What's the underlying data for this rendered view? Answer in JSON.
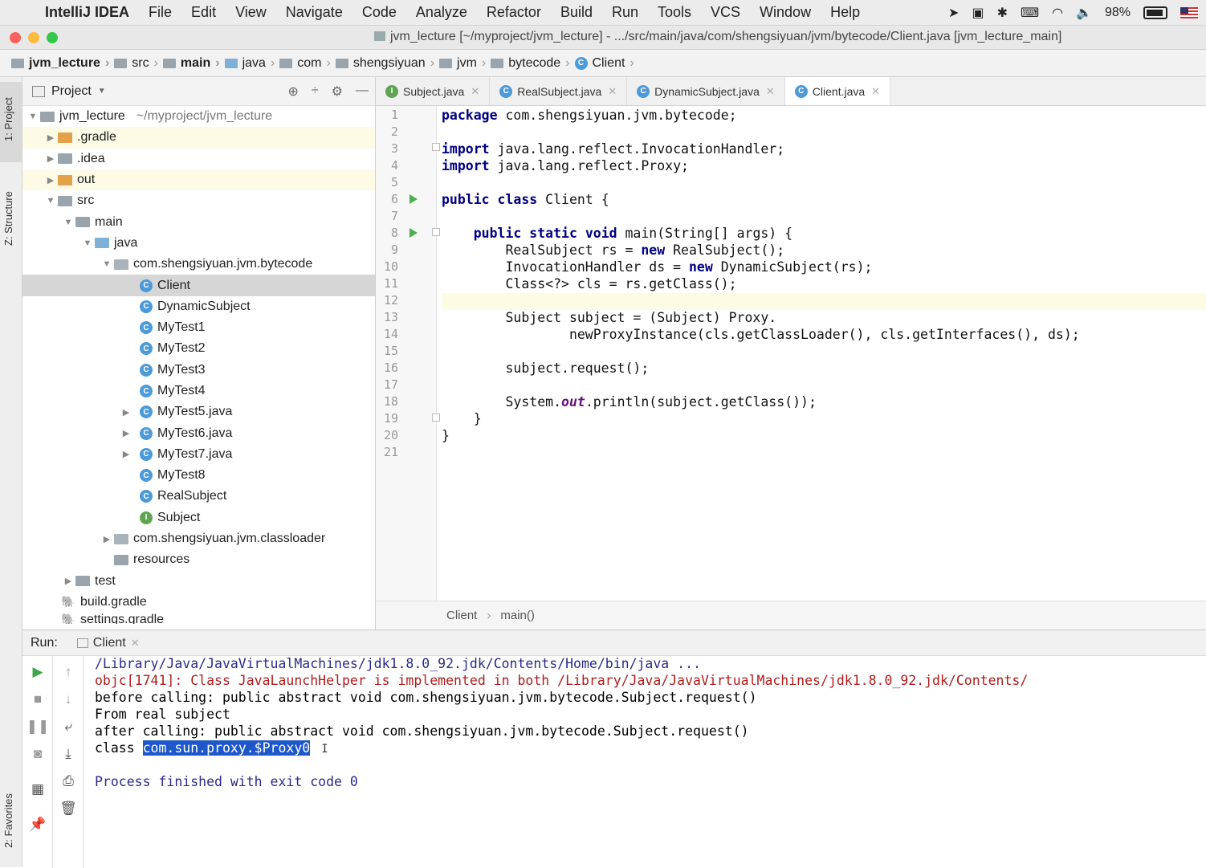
{
  "menubar": {
    "app": "IntelliJ IDEA",
    "items": [
      "File",
      "Edit",
      "View",
      "Navigate",
      "Code",
      "Analyze",
      "Refactor",
      "Build",
      "Run",
      "Tools",
      "VCS",
      "Window",
      "Help"
    ],
    "battery": "98%"
  },
  "window": {
    "title": "jvm_lecture [~/myproject/jvm_lecture] - .../src/main/java/com/shengsiyuan/jvm/bytecode/Client.java [jvm_lecture_main]"
  },
  "breadcrumb": [
    "jvm_lecture",
    "src",
    "main",
    "java",
    "com",
    "shengsiyuan",
    "jvm",
    "bytecode",
    "Client"
  ],
  "left_strip": {
    "project_tab": "1: Project",
    "structure_tab": "Z: Structure",
    "favorites_tab": "2: Favorites"
  },
  "project": {
    "title": "Project",
    "tree": [
      {
        "label": "jvm_lecture",
        "path": "~/myproject/jvm_lecture"
      },
      {
        "label": ".gradle"
      },
      {
        "label": ".idea"
      },
      {
        "label": "out"
      },
      {
        "label": "src"
      },
      {
        "label": "main"
      },
      {
        "label": "java"
      },
      {
        "label": "com.shengsiyuan.jvm.bytecode"
      },
      {
        "label": "Client"
      },
      {
        "label": "DynamicSubject"
      },
      {
        "label": "MyTest1"
      },
      {
        "label": "MyTest2"
      },
      {
        "label": "MyTest3"
      },
      {
        "label": "MyTest4"
      },
      {
        "label": "MyTest5.java"
      },
      {
        "label": "MyTest6.java"
      },
      {
        "label": "MyTest7.java"
      },
      {
        "label": "MyTest8"
      },
      {
        "label": "RealSubject"
      },
      {
        "label": "Subject"
      },
      {
        "label": "com.shengsiyuan.jvm.classloader"
      },
      {
        "label": "resources"
      },
      {
        "label": "test"
      },
      {
        "label": "build.gradle"
      },
      {
        "label": "settings.gradle"
      }
    ]
  },
  "editor": {
    "tabs": [
      "Subject.java",
      "RealSubject.java",
      "DynamicSubject.java",
      "Client.java"
    ],
    "active_tab": "Client.java",
    "line_numbers": [
      "1",
      "2",
      "3",
      "4",
      "5",
      "6",
      "7",
      "8",
      "9",
      "10",
      "11",
      "12",
      "13",
      "14",
      "15",
      "16",
      "17",
      "18",
      "19",
      "20",
      "21"
    ],
    "code": {
      "l1_kw": "package",
      "l1_rest": " com.shengsiyuan.jvm.bytecode;",
      "l3_kw": "import",
      "l3_rest": " java.lang.reflect.InvocationHandler;",
      "l4_kw": "import",
      "l4_rest": " java.lang.reflect.Proxy;",
      "l6_kw": "public class",
      "l6_rest": " Client {",
      "l8_ind": "    ",
      "l8_kw": "public static void",
      "l8_rest": " main(String[] args) {",
      "l9_a": "        RealSubject rs = ",
      "l9_kw": "new",
      "l9_b": " RealSubject();",
      "l10_a": "        InvocationHandler ds = ",
      "l10_kw": "new",
      "l10_b": " DynamicSubject(rs);",
      "l11": "        Class<?> cls = rs.getClass();",
      "l13": "        Subject subject = (Subject) Proxy.",
      "l14": "                newProxyInstance(cls.getClassLoader(), cls.getInterfaces(), ds);",
      "l16": "        subject.request();",
      "l18_a": "        System.",
      "l18_it": "out",
      "l18_b": ".println(subject.getClass());",
      "l19": "    }",
      "l20": "}"
    },
    "footer_breadcrumb": [
      "Client",
      "main()"
    ]
  },
  "run": {
    "label": "Run:",
    "tab": "Client",
    "output": {
      "line1": "/Library/Java/JavaVirtualMachines/jdk1.8.0_92.jdk/Contents/Home/bin/java ...",
      "line2": "objc[1741]: Class JavaLaunchHelper is implemented in both /Library/Java/JavaVirtualMachines/jdk1.8.0_92.jdk/Contents/",
      "line3": "before calling: public abstract void com.shengsiyuan.jvm.bytecode.Subject.request()",
      "line4": "From real subject",
      "line5": "after calling: public abstract void com.shengsiyuan.jvm.bytecode.Subject.request()",
      "line6_prefix": "class ",
      "line6_selected": "com.sun.proxy.$Proxy0",
      "line8": "Process finished with exit code 0"
    }
  }
}
